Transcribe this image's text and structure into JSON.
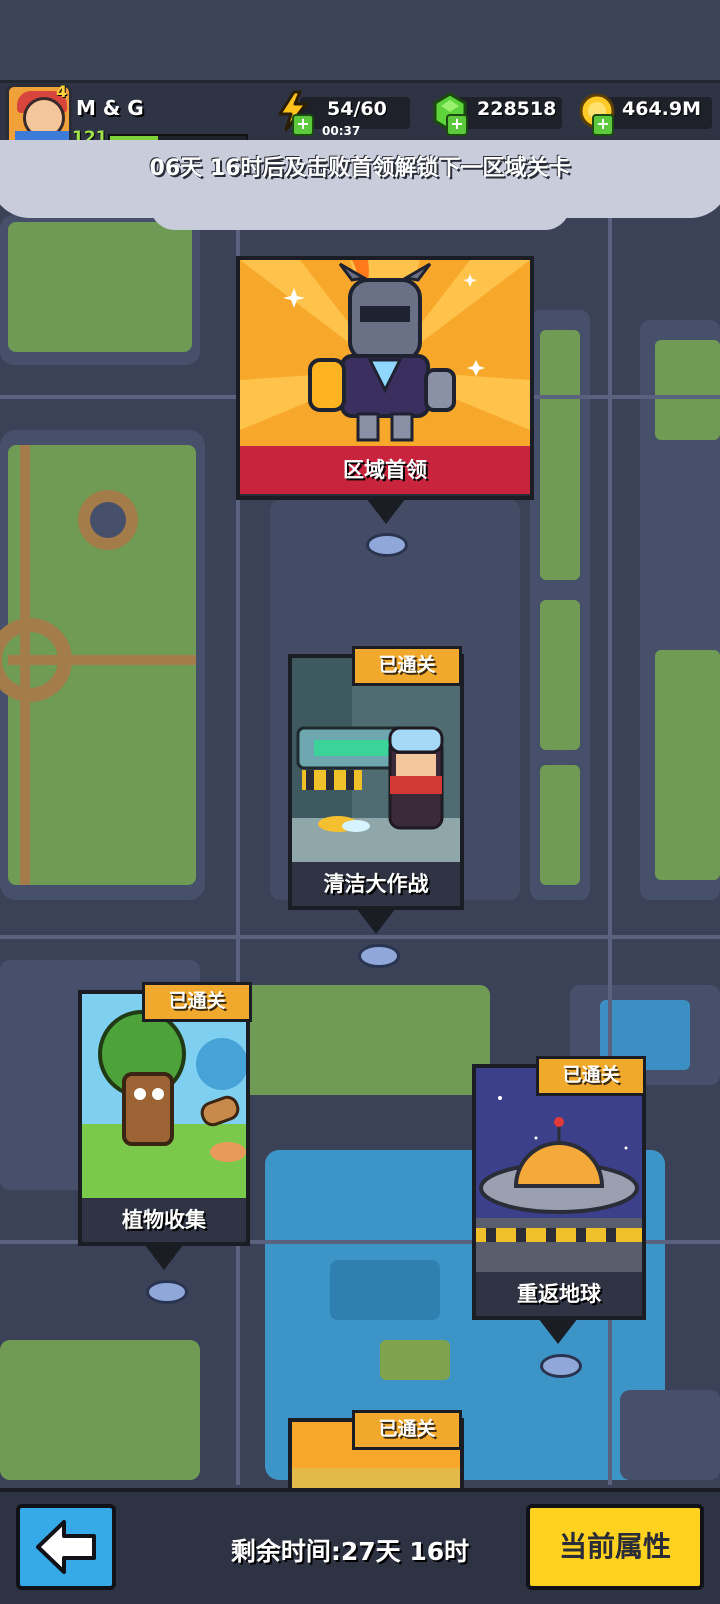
{
  "player": {
    "name": "M & G",
    "level": "121",
    "star_level": "4",
    "xp_progress": 0.35
  },
  "resources": {
    "energy": "54/60",
    "energy_timer": "00:37",
    "gems": "228518",
    "gold": "464.9M"
  },
  "notice": "06天 16时后及击败首领解锁下一区域关卡",
  "boss": {
    "label": "区域首领"
  },
  "stages": [
    {
      "label": "清洁大作战",
      "status": "已通关"
    },
    {
      "label": "植物收集",
      "status": "已通关"
    },
    {
      "label": "重返地球",
      "status": "已通关"
    },
    {
      "label": "",
      "status": "已通关"
    }
  ],
  "bottom": {
    "remaining_time": "剩余时间:27天 16时",
    "attributes_button": "当前属性"
  },
  "icons": {
    "energy": "lightning-bolt-icon",
    "gems": "green-gem-icon",
    "gold": "gold-coin-icon",
    "back": "arrow-left-icon"
  },
  "colors": {
    "accent_yellow": "#ffd21f",
    "back_blue": "#36a9e8",
    "boss_red": "#c8243d",
    "badge_orange": "#f0a92c"
  }
}
